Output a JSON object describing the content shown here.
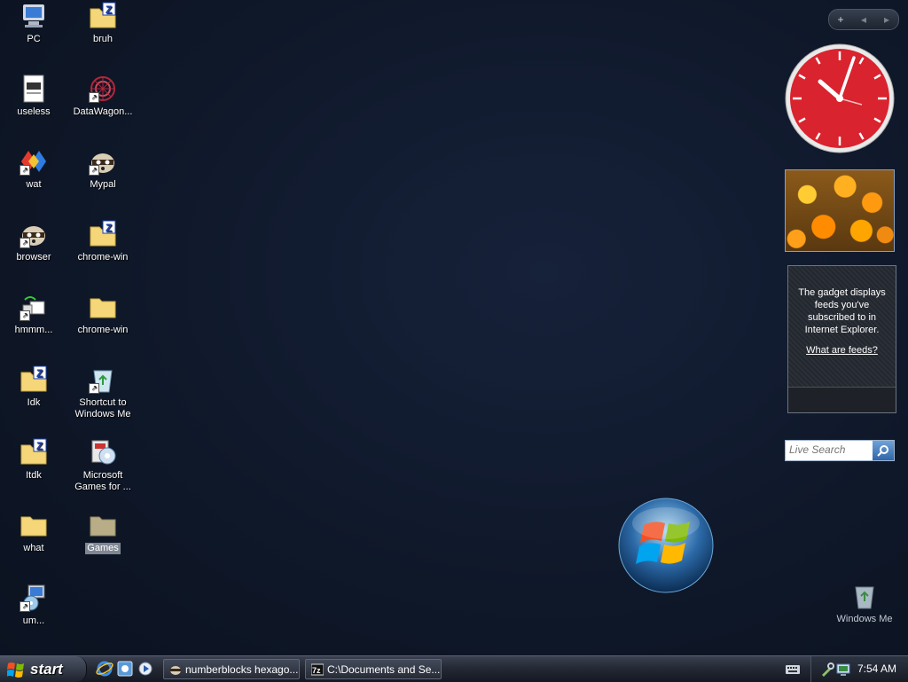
{
  "desktop": {
    "icons": [
      {
        "label": "PC",
        "icon": "computer-icon"
      },
      {
        "label": "bruh",
        "icon": "zip-folder-icon"
      },
      {
        "label": "useless",
        "icon": "text-file-icon"
      },
      {
        "label": "DataWagon...",
        "icon": "datawagon-icon"
      },
      {
        "label": "wat",
        "icon": "app-icon"
      },
      {
        "label": "Mypal",
        "icon": "raccoon-icon"
      },
      {
        "label": "browser",
        "icon": "raccoon-icon"
      },
      {
        "label": "chrome-win",
        "icon": "zip-folder-icon"
      },
      {
        "label": "hmmm...",
        "icon": "network-icon"
      },
      {
        "label": "chrome-win",
        "icon": "folder-icon"
      },
      {
        "label": "Idk",
        "icon": "zip-folder-icon"
      },
      {
        "label": "Shortcut to Windows Me",
        "icon": "recycle-bin-icon"
      },
      {
        "label": "Itdk",
        "icon": "zip-folder-icon"
      },
      {
        "label": "Microsoft Games for ...",
        "icon": "games-icon"
      },
      {
        "label": "what",
        "icon": "folder-icon"
      },
      {
        "label": "Games",
        "icon": "folder-icon"
      },
      {
        "label": "um...",
        "icon": "setup-icon"
      }
    ]
  },
  "sidebar": {
    "controls": {
      "add": "+",
      "prev": "◂",
      "next": "▸"
    },
    "feed": {
      "message": "The gadget displays feeds you've subscribed to in Internet Explorer.",
      "link": "What are feeds?"
    },
    "search": {
      "placeholder": "Live Search"
    }
  },
  "recycle_bin": {
    "label": "Windows Me"
  },
  "taskbar": {
    "start_label": "start",
    "tasks": [
      {
        "label": "numberblocks hexago...",
        "icon": "raccoon-icon"
      },
      {
        "label": "C:\\Documents and Se...",
        "icon": "7zip-icon"
      }
    ],
    "time": "7:54 AM"
  },
  "colors": {
    "desktop": "#0f1829",
    "clock_face": "#d9232e",
    "taskbar": "#242935"
  }
}
